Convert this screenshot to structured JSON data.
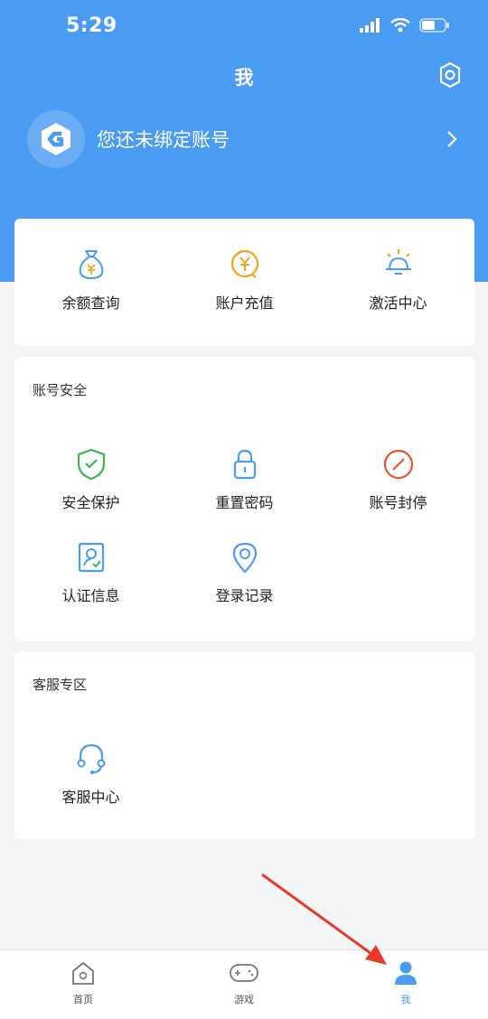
{
  "status_bar": {
    "time": "5:29"
  },
  "header": {
    "title": "我"
  },
  "account": {
    "text": "您还未绑定账号"
  },
  "quick_actions": [
    {
      "label": "余额查询",
      "icon": "money-bag-icon"
    },
    {
      "label": "账户充值",
      "icon": "recharge-icon"
    },
    {
      "label": "激活中心",
      "icon": "lightbulb-icon"
    }
  ],
  "security": {
    "title": "账号安全",
    "items": [
      {
        "label": "安全保护",
        "icon": "shield-check-icon"
      },
      {
        "label": "重置密码",
        "icon": "lock-icon"
      },
      {
        "label": "账号封停",
        "icon": "ban-icon"
      },
      {
        "label": "认证信息",
        "icon": "id-card-icon"
      },
      {
        "label": "登录记录",
        "icon": "location-pin-icon"
      }
    ]
  },
  "service": {
    "title": "客服专区",
    "items": [
      {
        "label": "客服中心",
        "icon": "headset-icon"
      }
    ]
  },
  "bottom_nav": [
    {
      "label": "首页",
      "icon": "home-icon",
      "active": false
    },
    {
      "label": "游戏",
      "icon": "gamepad-icon",
      "active": false
    },
    {
      "label": "我",
      "icon": "user-icon",
      "active": true
    }
  ],
  "colors": {
    "primary": "#4a9cf2",
    "green": "#3db34a",
    "orange": "#f0a21a",
    "red": "#e8542f"
  }
}
